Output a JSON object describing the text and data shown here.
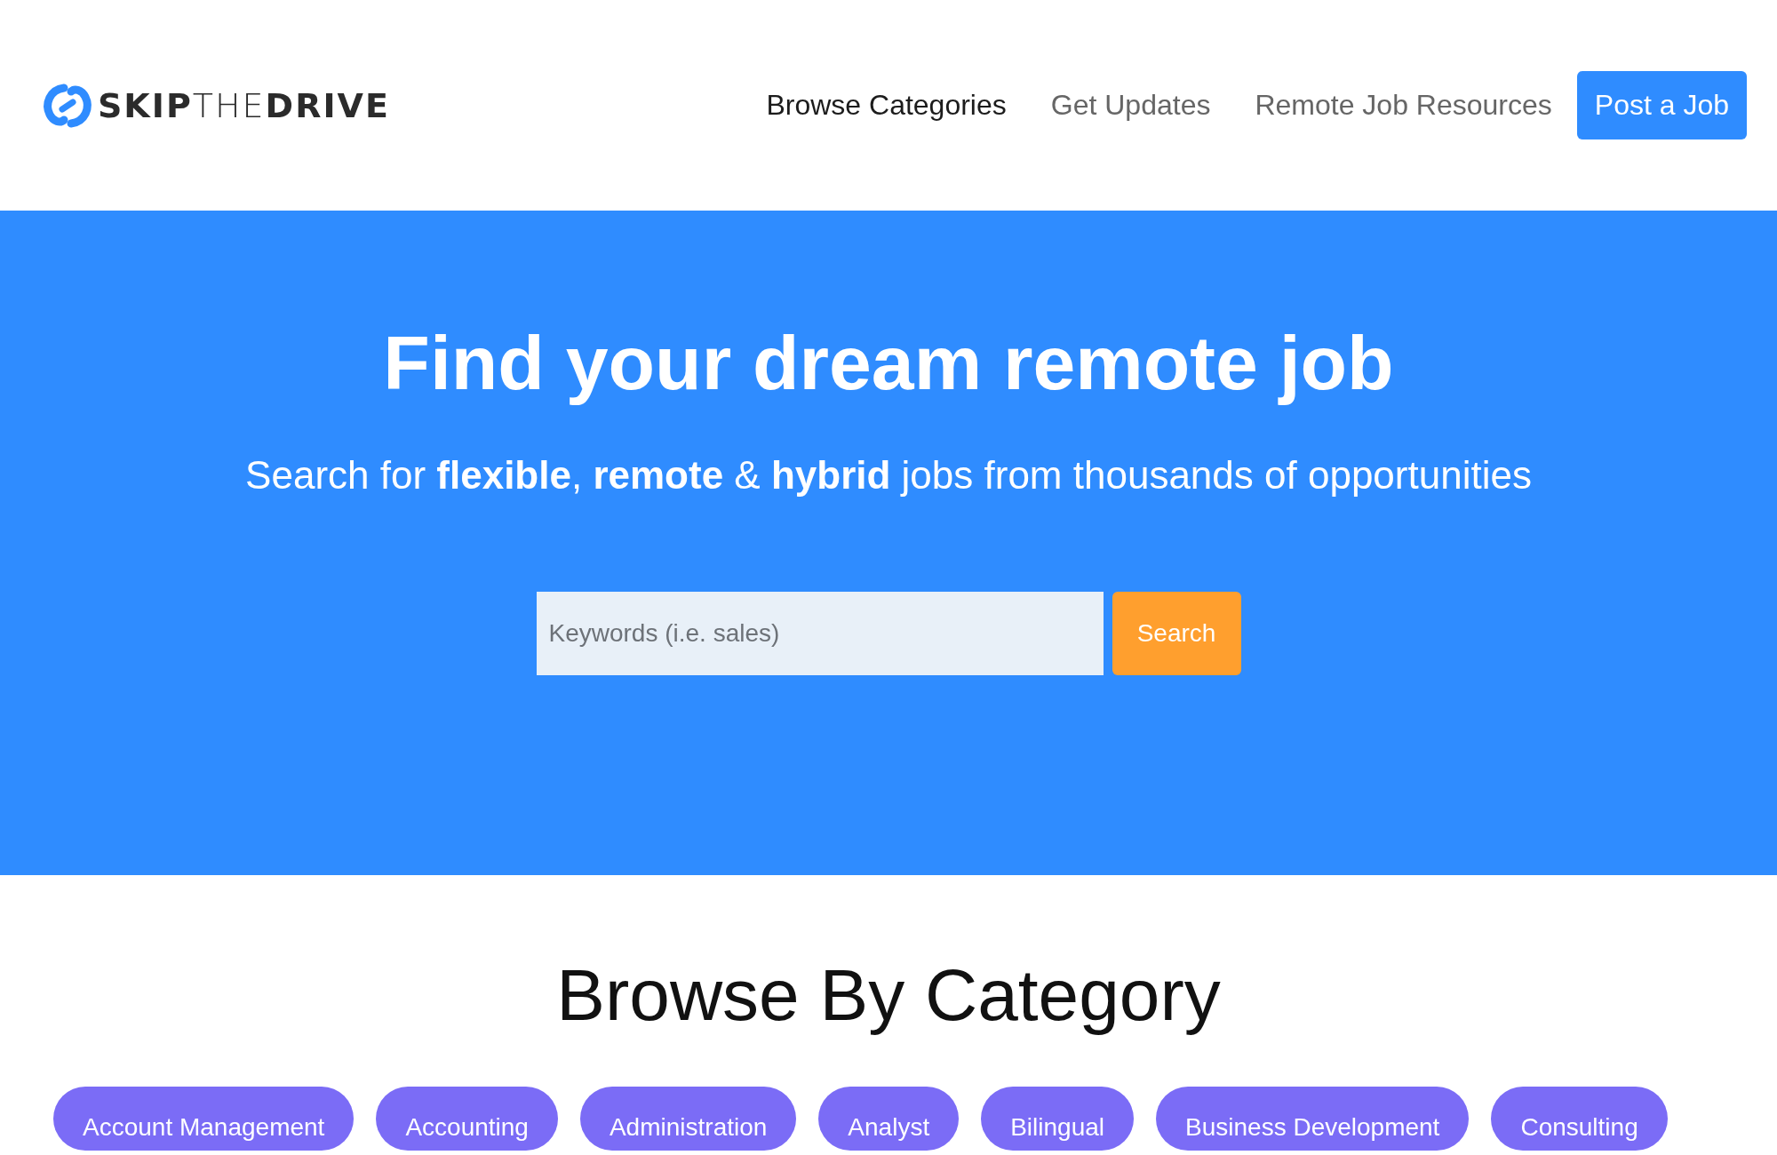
{
  "header": {
    "logo": "**SKIP**THE**DRIVE**",
    "nav": [
      {
        "label": "Browse Categories",
        "selected": true
      },
      {
        "label": "Get Updates",
        "selected": false
      },
      {
        "label": "Remote Job Resources",
        "selected": false
      }
    ],
    "post_button": "Post a Job"
  },
  "hero": {
    "title": "Find your dream remote job",
    "subtitle": "Search for **flexible**, **remote** & **hybrid** jobs from thousands of opportunities",
    "search": {
      "placeholder": "Keywords (i.e. sales)",
      "button": "Search"
    }
  },
  "categories": {
    "heading": "Browse By Category",
    "items": [
      "Account Management",
      "Accounting",
      "Administration",
      "Analyst",
      "Bilingual",
      "Business Development",
      "Consulting"
    ]
  }
}
